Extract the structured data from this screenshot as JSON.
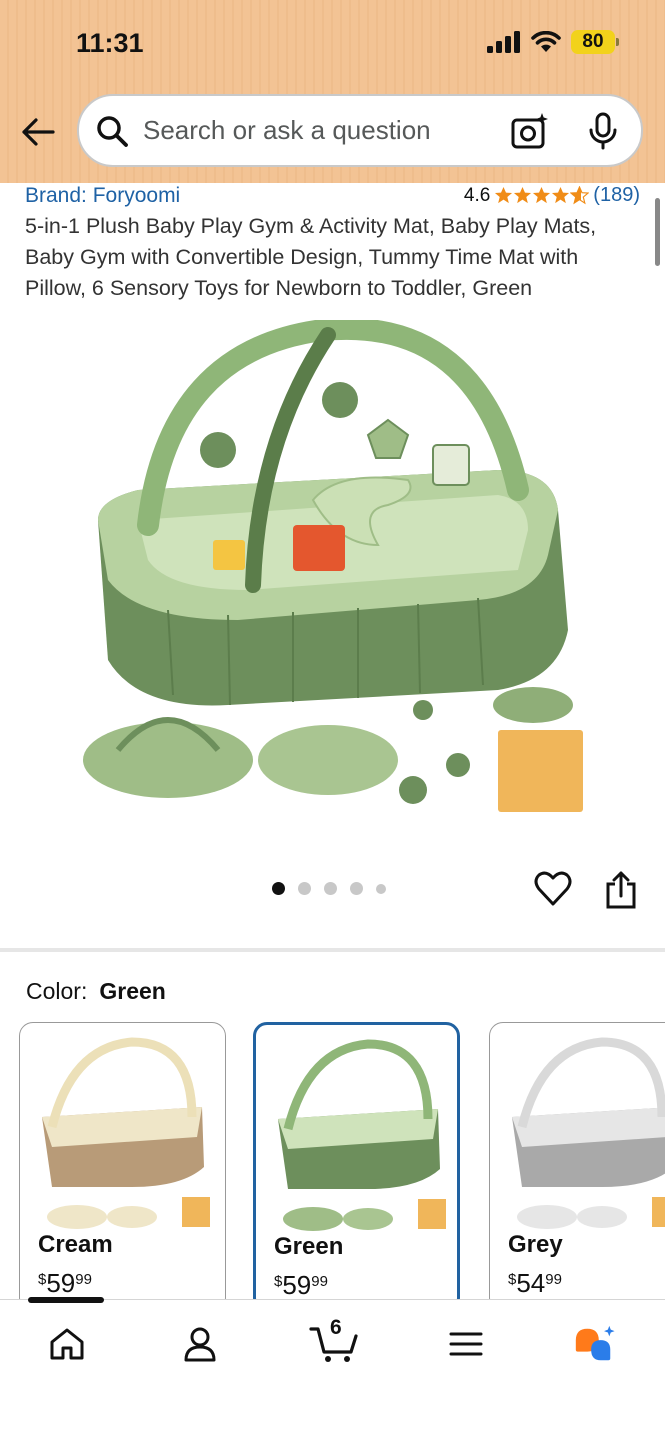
{
  "status_bar": {
    "time": "11:31",
    "battery": "80"
  },
  "search": {
    "placeholder": "Search or ask a question"
  },
  "product": {
    "brand": "Brand: Foryoomi",
    "rating": "4.6",
    "review_count": "(189)",
    "title": "5-in-1 Plush Baby Play Gym & Activity Mat, Baby Play Mats, Baby Gym with Convertible Design, Tummy Time Mat with Pillow, 6 Sensory Toys for Newborn to Toddler, Green"
  },
  "carousel": {
    "total_images": 5,
    "active_index": 0
  },
  "color_selector": {
    "label": "Color:",
    "selected": "Green",
    "options": [
      {
        "name": "Cream",
        "currency": "$",
        "whole": "59",
        "fraction": "99",
        "tint": "#d8c7a3"
      },
      {
        "name": "Green",
        "currency": "$",
        "whole": "59",
        "fraction": "99",
        "tint": "#8fae78"
      },
      {
        "name": "Grey",
        "currency": "$",
        "whole": "54",
        "fraction": "99",
        "tint": "#c9c9c9"
      }
    ]
  },
  "bottom_nav": {
    "items": [
      "home-icon",
      "account-icon",
      "cart-icon",
      "menu-icon",
      "rufus-icon"
    ],
    "cart_count": "6"
  },
  "colors": {
    "header_bg": "#f3c394",
    "link_blue": "#1f62a5",
    "star_orange": "#f08c17",
    "selected_border": "#2162a1",
    "rufus_orange": "#ff7a1a",
    "rufus_blue": "#2b7de9"
  }
}
